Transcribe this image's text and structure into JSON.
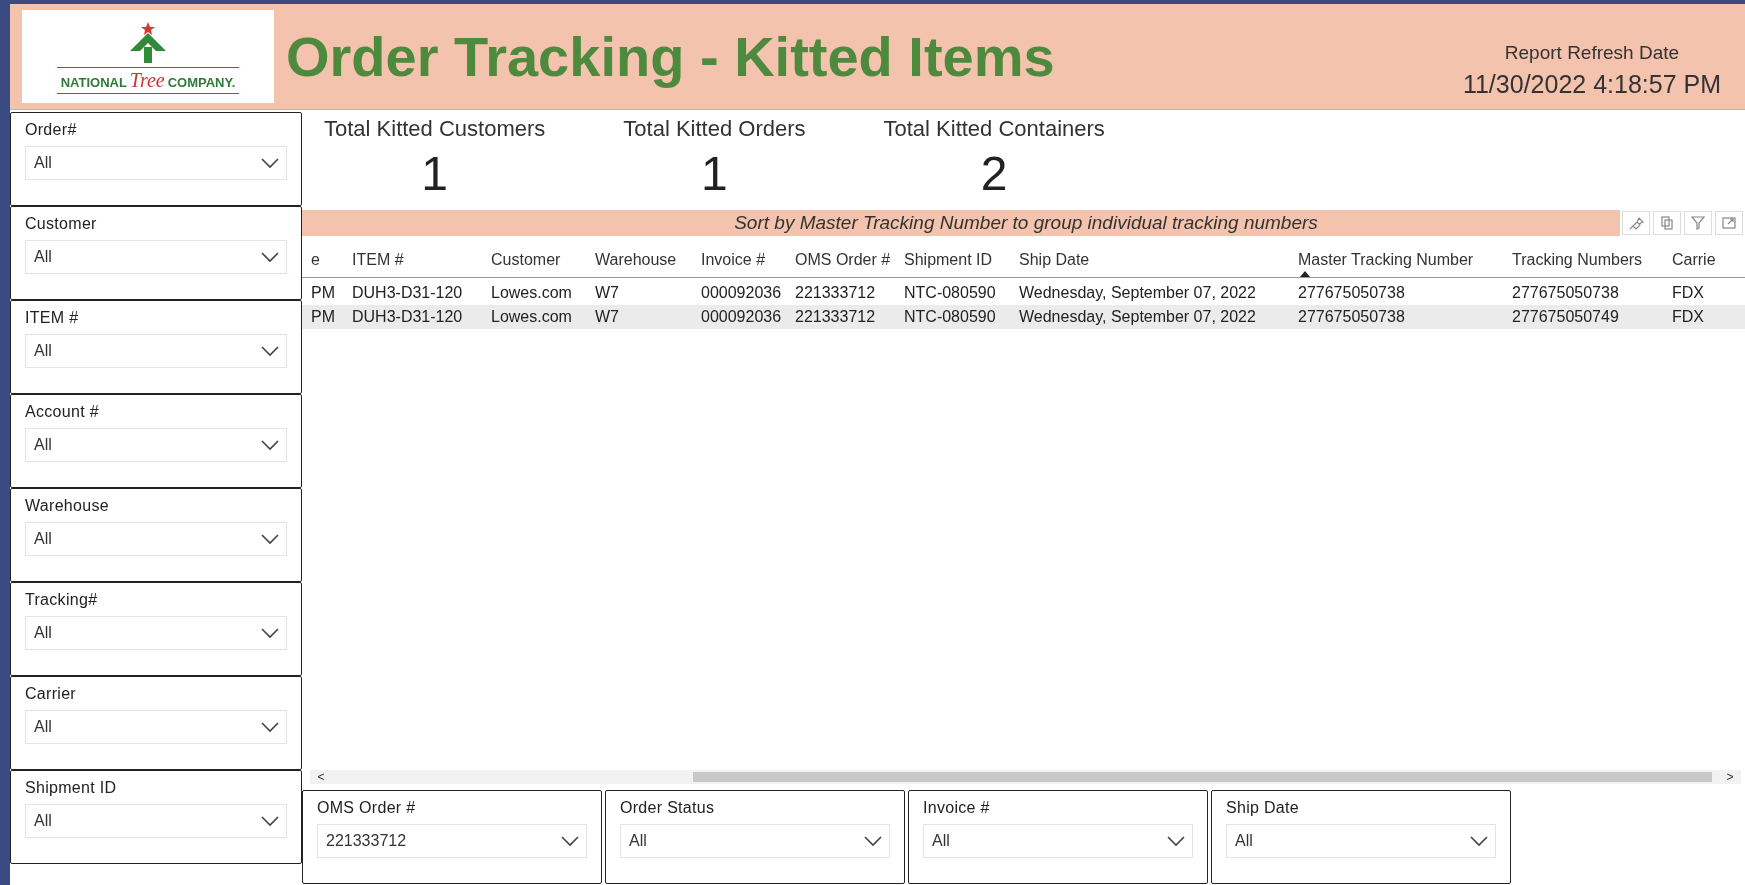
{
  "header": {
    "logo": {
      "word_1": "NATIONAL",
      "word_2": "Tree",
      "word_3": "COMPANY."
    },
    "title": "Order Tracking - Kitted Items",
    "refresh_label": "Report Refresh Date",
    "refresh_value": "11/30/2022 4:18:57 PM"
  },
  "sidebar_filters": [
    {
      "label": "Order#",
      "value": "All"
    },
    {
      "label": "Customer",
      "value": "All"
    },
    {
      "label": "ITEM #",
      "value": "All"
    },
    {
      "label": "Account #",
      "value": "All"
    },
    {
      "label": "Warehouse",
      "value": "All"
    },
    {
      "label": "Tracking#",
      "value": "All"
    },
    {
      "label": "Carrier",
      "value": "All"
    },
    {
      "label": "Shipment ID",
      "value": "All"
    }
  ],
  "kpis": [
    {
      "label": "Total Kitted Customers",
      "value": "1"
    },
    {
      "label": "Total Kitted Orders",
      "value": "1"
    },
    {
      "label": "Total Kitted Containers",
      "value": "2"
    }
  ],
  "table": {
    "banner": "Sort by Master Tracking Number to group individual tracking numbers",
    "columns": [
      {
        "label": "e",
        "sorted": false
      },
      {
        "label": "ITEM #",
        "sorted": false
      },
      {
        "label": "Customer",
        "sorted": false
      },
      {
        "label": "Warehouse",
        "sorted": false
      },
      {
        "label": "Invoice #",
        "sorted": false
      },
      {
        "label": "OMS Order #",
        "sorted": false
      },
      {
        "label": "Shipment ID",
        "sorted": false
      },
      {
        "label": "Ship Date",
        "sorted": false
      },
      {
        "label": "Master Tracking Number",
        "sorted": true
      },
      {
        "label": "Tracking Numbers",
        "sorted": false
      },
      {
        "label": "Carrie",
        "sorted": false
      }
    ],
    "rows": [
      [
        "PM",
        "DUH3-D31-120",
        "Lowes.com",
        "W7",
        "000092036",
        "221333712",
        "NTC-080590",
        "Wednesday, September 07, 2022",
        "277675050738",
        "277675050738",
        "FDX"
      ],
      [
        "PM",
        "DUH3-D31-120",
        "Lowes.com",
        "W7",
        "000092036",
        "221333712",
        "NTC-080590",
        "Wednesday, September 07, 2022",
        "277675050738",
        "277675050749",
        "FDX"
      ]
    ],
    "scroll_left": "<",
    "scroll_right": ">"
  },
  "bottom_filters": [
    {
      "label": "OMS Order #",
      "value": "221333712"
    },
    {
      "label": "Order Status",
      "value": "All"
    },
    {
      "label": "Invoice #",
      "value": "All"
    },
    {
      "label": "Ship Date",
      "value": "All"
    }
  ]
}
